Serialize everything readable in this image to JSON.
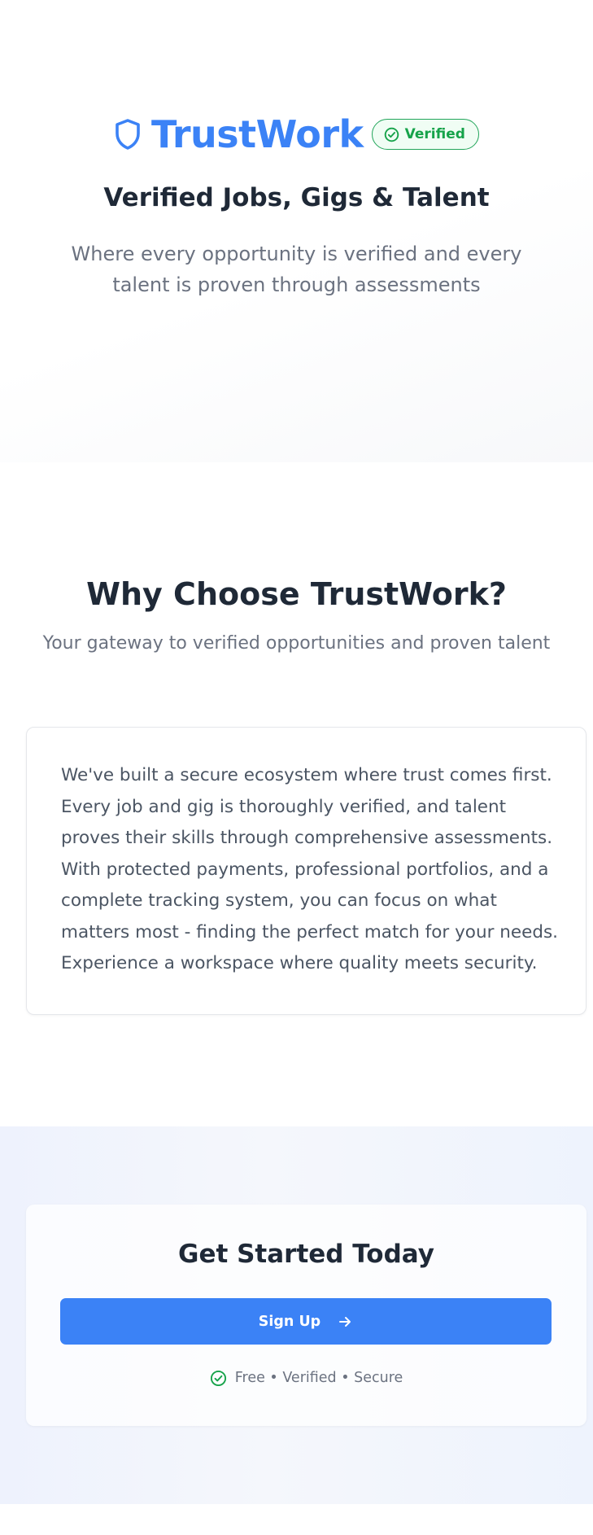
{
  "colors": {
    "brand_blue": "#3b82f6",
    "verified_green": "#16a34a",
    "heading_dark": "#1f2937",
    "muted_gray": "#6b7280"
  },
  "hero": {
    "logo_icon": "shield-icon",
    "brand_name": "TrustWork",
    "badge": {
      "icon": "check-circle-icon",
      "label": "Verified"
    },
    "subtitle": "Verified Jobs, Gigs & Talent",
    "description": "Where every opportunity is verified and every talent is proven through assessments"
  },
  "why": {
    "title": "Why Choose TrustWork?",
    "subtitle": "Your gateway to verified opportunities and proven talent",
    "body": "We've built a secure ecosystem where trust comes first. Every job and gig is thoroughly verified, and talent proves their skills through comprehensive assessments. With protected payments, professional portfolios, and a complete tracking system, you can focus on what matters most - finding the perfect match for your needs. Experience a workspace where quality meets security."
  },
  "cta": {
    "title": "Get Started Today",
    "button_label": "Sign Up",
    "button_icon": "arrow-right-icon",
    "footnote_icon": "check-circle-icon",
    "footnote": "Free • Verified • Secure"
  }
}
